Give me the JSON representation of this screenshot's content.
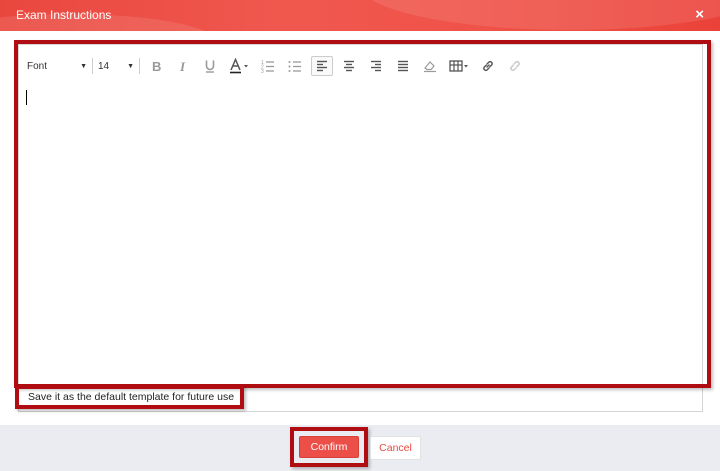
{
  "dialog": {
    "title": "Exam Instructions",
    "close_label": "×"
  },
  "toolbar": {
    "font_label": "Font",
    "size_label": "14",
    "buttons": [
      "bold-icon",
      "italic-icon",
      "underline-icon",
      "font-color-icon",
      "ordered-list-icon",
      "unordered-list-icon",
      "align-left-icon",
      "align-center-icon",
      "align-right-icon",
      "align-justify-icon",
      "clear-format-icon",
      "table-icon",
      "link-icon",
      "unlink-icon"
    ],
    "active_button": "align-left-icon"
  },
  "editor": {
    "content": ""
  },
  "save_default_label": "Save it as the default template for future use",
  "footer": {
    "confirm_label": "Confirm",
    "cancel_label": "Cancel"
  },
  "colors": {
    "accent": "#ec4f47",
    "highlight": "#b00d12",
    "footer_bg": "#ebebf2"
  }
}
